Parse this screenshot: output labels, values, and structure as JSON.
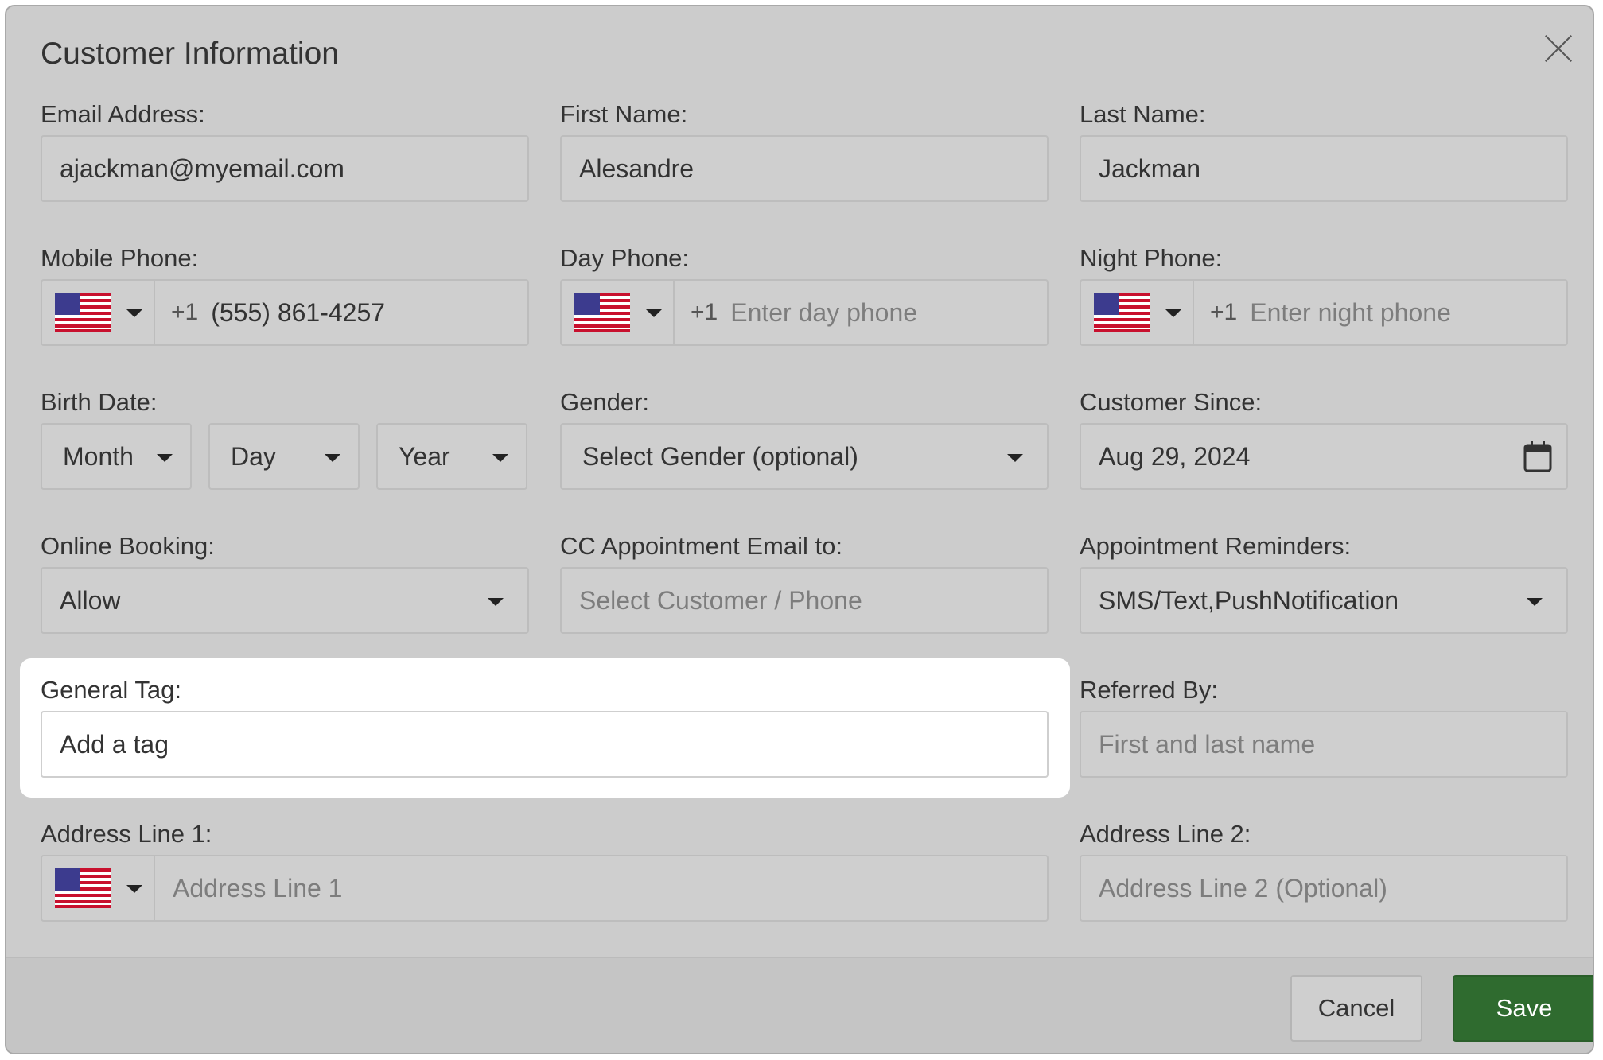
{
  "dialog": {
    "title": "Customer Information"
  },
  "fields": {
    "email": {
      "label": "Email Address:",
      "value": "ajackman@myemail.com"
    },
    "first_name": {
      "label": "First Name:",
      "value": "Alesandre"
    },
    "last_name": {
      "label": "Last Name:",
      "value": "Jackman"
    },
    "mobile_phone": {
      "label": "Mobile Phone:",
      "prefix": "+1",
      "value": "(555) 861-4257"
    },
    "day_phone": {
      "label": "Day Phone:",
      "prefix": "+1",
      "placeholder": "Enter day phone"
    },
    "night_phone": {
      "label": "Night Phone:",
      "prefix": "+1",
      "placeholder": "Enter night phone"
    },
    "birth_date": {
      "label": "Birth Date:",
      "month": "Month",
      "day": "Day",
      "year": "Year"
    },
    "gender": {
      "label": "Gender:",
      "value": "Select Gender (optional)"
    },
    "customer_since": {
      "label": "Customer Since:",
      "value": "Aug 29, 2024"
    },
    "online_booking": {
      "label": "Online Booking:",
      "value": "Allow"
    },
    "cc_email": {
      "label": "CC Appointment Email to:",
      "placeholder": "Select Customer / Phone"
    },
    "reminders": {
      "label": "Appointment Reminders:",
      "value": "SMS/Text,PushNotification"
    },
    "general_tag": {
      "label": "General Tag:",
      "placeholder": "Add a tag"
    },
    "referred_by": {
      "label": "Referred By:",
      "placeholder": "First and last name"
    },
    "address1": {
      "label": "Address Line 1:",
      "placeholder": "Address Line 1"
    },
    "address2": {
      "label": "Address Line 2:",
      "placeholder": "Address Line 2 (Optional)"
    }
  },
  "buttons": {
    "cancel": "Cancel",
    "save": "Save"
  },
  "icons": {
    "flag": "us-flag-icon",
    "calendar": "calendar-icon",
    "close": "close-icon",
    "dropdown": "chevron-down-icon"
  },
  "colors": {
    "save_button": "#2f6b2f",
    "highlight": "#ffffff"
  }
}
